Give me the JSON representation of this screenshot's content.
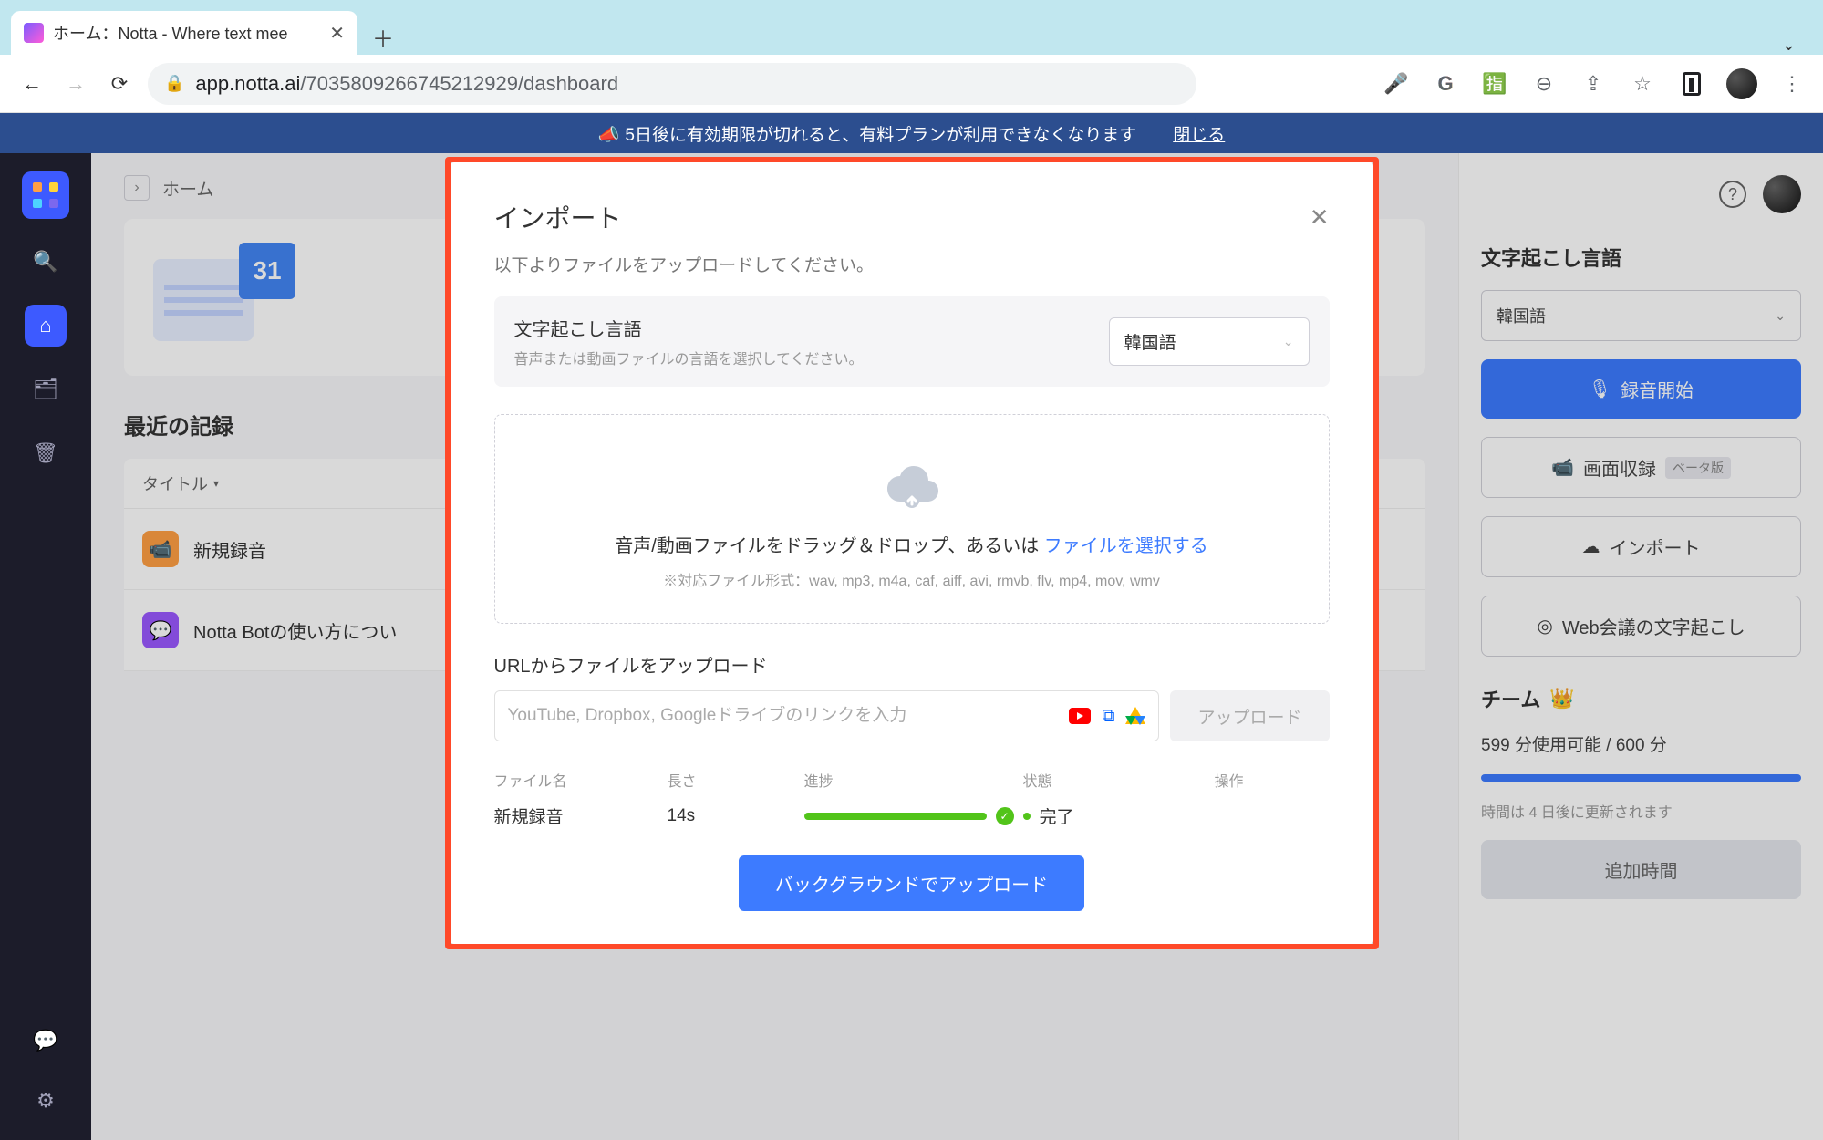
{
  "browser": {
    "tab_title": "ホーム：Notta - Where text mee",
    "url_host": "app.notta.ai",
    "url_path": "/7035809266745212929/dashboard"
  },
  "banner": {
    "text": "5日後に有効期限が切れると、有料プランが利用できなくなります",
    "close": "閉じる"
  },
  "breadcrumb": "ホーム",
  "calendar_day": "31",
  "recent_heading": "最近の記録",
  "filters": {
    "title": "タイトル"
  },
  "list": {
    "new_recording": "新規録音",
    "notta_bot": "Notta Botの使い方につい"
  },
  "right_panel": {
    "lang_label": "文字起こし言語",
    "lang_value": "韓国語",
    "record_btn": "録音開始",
    "screen_btn": "画面収録",
    "beta_badge": "ベータ版",
    "import_btn": "インポート",
    "meeting_btn": "Web会議の文字起こし",
    "team_heading": "チーム",
    "quota": "599 分使用可能 / 600 分",
    "quota_note": "時間は 4 日後に更新されます",
    "add_time": "追加時間"
  },
  "modal": {
    "title": "インポート",
    "subtitle": "以下よりファイルをアップロードしてください。",
    "lang_title": "文字起こし言語",
    "lang_sub": "音声または動画ファイルの言語を選択してください。",
    "lang_value": "韓国語",
    "drop_text": "音声/動画ファイルをドラッグ＆ドロップ、あるいは ",
    "drop_link": "ファイルを選択する",
    "drop_formats": "※対応ファイル形式：wav, mp3, m4a, caf, aiff, avi, rmvb, flv, mp4, mov, wmv",
    "url_heading": "URLからファイルをアップロード",
    "url_placeholder": "YouTube, Dropbox, Googleドライブのリンクを入力",
    "upload_btn": "アップロード",
    "table": {
      "head_filename": "ファイル名",
      "head_length": "長さ",
      "head_progress": "進捗",
      "head_status": "状態",
      "head_action": "操作",
      "row_filename": "新規録音",
      "row_length": "14s",
      "row_status": "完了"
    },
    "bg_upload": "バックグラウンドでアップロード"
  }
}
